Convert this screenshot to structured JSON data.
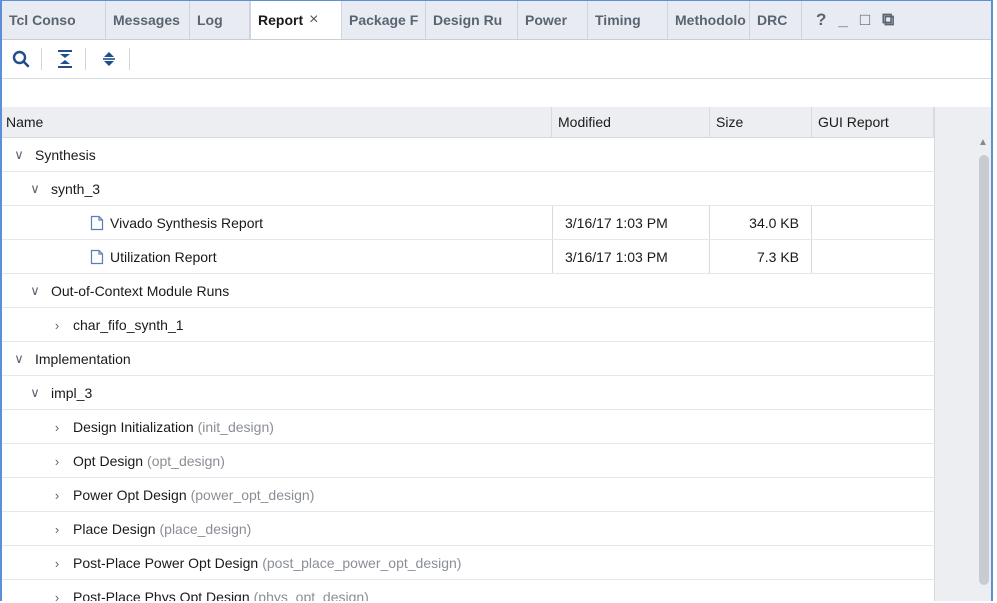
{
  "tabs": [
    {
      "label": "Tcl Conso",
      "width": 104
    },
    {
      "label": "Messages",
      "width": 84
    },
    {
      "label": "Log",
      "width": 60
    },
    {
      "label": "Report",
      "width": 92,
      "active": true,
      "close": "×"
    },
    {
      "label": "Package F",
      "width": 84
    },
    {
      "label": "Design Ru",
      "width": 92
    },
    {
      "label": "Power",
      "width": 70
    },
    {
      "label": "Timing",
      "width": 80
    },
    {
      "label": "Methodolo",
      "width": 82
    },
    {
      "label": "DRC",
      "width": 52
    }
  ],
  "window_controls": {
    "help": "?",
    "minimize": "_",
    "maximize": "□",
    "float": "⧉"
  },
  "table": {
    "columns": {
      "name": "Name",
      "modified": "Modified",
      "size": "Size",
      "gui_report": "GUI Report"
    }
  },
  "rows": [
    {
      "level": 0,
      "chev": "∨",
      "label": "Synthesis",
      "cmd": "",
      "modified": "",
      "size": "",
      "file": false
    },
    {
      "level": 1,
      "chev": "∨",
      "label": "synth_3",
      "cmd": "",
      "modified": "",
      "size": "",
      "file": false
    },
    {
      "level": 2,
      "chev": "",
      "label": "Vivado Synthesis Report",
      "cmd": "",
      "modified": "3/16/17 1:03 PM",
      "size": "34.0 KB",
      "file": true
    },
    {
      "level": 2,
      "chev": "",
      "label": "Utilization Report",
      "cmd": "",
      "modified": "3/16/17 1:03 PM",
      "size": "7.3 KB",
      "file": true
    },
    {
      "level": 1,
      "chev": "∨",
      "label": "Out-of-Context Module Runs",
      "cmd": "",
      "modified": "",
      "size": "",
      "file": false
    },
    {
      "level": 2,
      "chev": "›",
      "label": "char_fifo_synth_1",
      "cmd": "",
      "modified": "",
      "size": "",
      "file": false
    },
    {
      "level": 0,
      "chev": "∨",
      "label": "Implementation",
      "cmd": "",
      "modified": "",
      "size": "",
      "file": false
    },
    {
      "level": 1,
      "chev": "∨",
      "label": "impl_3",
      "cmd": "",
      "modified": "",
      "size": "",
      "file": false
    },
    {
      "level": 2,
      "chev": "›",
      "label": "Design Initialization",
      "cmd": "(init_design)",
      "modified": "",
      "size": "",
      "file": false
    },
    {
      "level": 2,
      "chev": "›",
      "label": "Opt Design",
      "cmd": "(opt_design)",
      "modified": "",
      "size": "",
      "file": false
    },
    {
      "level": 2,
      "chev": "›",
      "label": "Power Opt Design",
      "cmd": "(power_opt_design)",
      "modified": "",
      "size": "",
      "file": false
    },
    {
      "level": 2,
      "chev": "›",
      "label": "Place Design",
      "cmd": "(place_design)",
      "modified": "",
      "size": "",
      "file": false
    },
    {
      "level": 2,
      "chev": "›",
      "label": "Post-Place Power Opt Design",
      "cmd": "(post_place_power_opt_design)",
      "modified": "",
      "size": "",
      "file": false
    },
    {
      "level": 2,
      "chev": "›",
      "label": "Post-Place Phys Opt Design",
      "cmd": "(phys_opt_design)",
      "modified": "",
      "size": "",
      "file": false
    }
  ]
}
